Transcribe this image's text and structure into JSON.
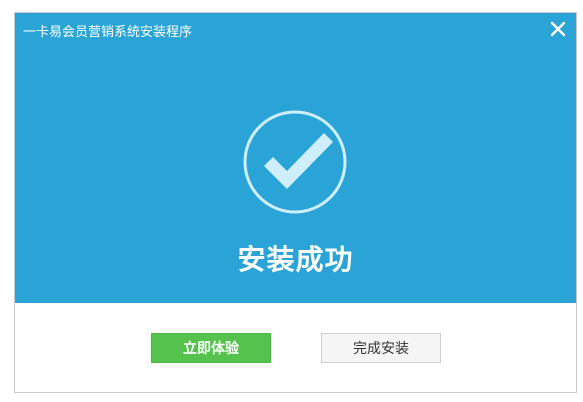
{
  "window": {
    "title": "一卡易会员营销系统安装程序"
  },
  "status": {
    "message": "安装成功"
  },
  "buttons": {
    "try_now": "立即体验",
    "finish": "完成安装"
  },
  "colors": {
    "banner": "#2aa4d6",
    "primary_button": "#55c24e",
    "check_fill": "#cfeefb"
  },
  "icons": {
    "close": "close-icon",
    "success": "checkmark-circle-icon"
  }
}
